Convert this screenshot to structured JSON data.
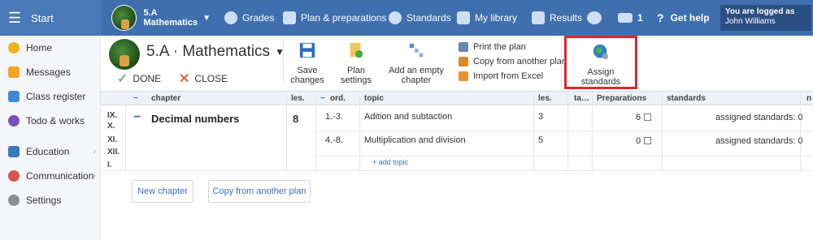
{
  "topbar": {
    "start_label": "Start",
    "class_name": "5.A",
    "class_subject": "Mathematics",
    "nav": [
      {
        "label": "Grades",
        "icon": "grades-icon"
      },
      {
        "label": "Plan & preparations",
        "icon": "plan-icon"
      },
      {
        "label": "Standards",
        "icon": "shield-icon"
      },
      {
        "label": "My library",
        "icon": "library-icon"
      },
      {
        "label": "Results",
        "icon": "results-icon"
      }
    ],
    "mail_count": "1",
    "help_label": "Get help",
    "logged_as_label": "You are logged as",
    "user_name": "John Williams"
  },
  "sidebar": {
    "items": [
      {
        "label": "Home",
        "icon": "star-icon",
        "color": "#f2b21c"
      },
      {
        "label": "Messages",
        "icon": "envelope-icon",
        "color": "#f5a623"
      },
      {
        "label": "Class register",
        "icon": "register-icon",
        "color": "#3a8bd6"
      },
      {
        "label": "Todo & works",
        "icon": "clock-icon",
        "color": "#7c4dbd"
      },
      {
        "label": "Education",
        "icon": "book-icon",
        "color": "#3a7ac0"
      },
      {
        "label": "Communication",
        "icon": "chat-icon",
        "color": "#d9534f"
      },
      {
        "label": "Settings",
        "icon": "gear-icon",
        "color": "#8a8f96"
      }
    ]
  },
  "toolbar": {
    "title": "5.A · Mathematics",
    "done_label": "DONE",
    "close_label": "CLOSE",
    "save_label_1": "Save",
    "save_label_2": "changes",
    "plan_settings_1": "Plan",
    "plan_settings_2": "settings",
    "add_chapter_1": "Add an empty",
    "add_chapter_2": "chapter",
    "print_label": "Print the plan",
    "copy_label": "Copy from another plan",
    "import_label": "Import from Excel",
    "assign_1": "Assign",
    "assign_2": "standards"
  },
  "table": {
    "headers": [
      "chapter",
      "les.",
      "ord.",
      "topic",
      "les.",
      "ta…",
      "Preparations",
      "standards",
      "n"
    ],
    "month_rows": [
      "IX.",
      "X.",
      "XI.",
      "XII.",
      "I."
    ],
    "chapter": {
      "name": "Decimal numbers",
      "lessons": "8"
    },
    "topics": [
      {
        "ord": "1.-3.",
        "topic": "Adition and subtaction",
        "lessons": "3",
        "preparations": "6",
        "standards": "assigned standards: 0"
      },
      {
        "ord": "4.-8.",
        "topic": "Multiplication and division",
        "lessons": "5",
        "preparations": "0",
        "standards": "assigned standards: 0"
      }
    ],
    "add_topic_label": "+ add topic"
  },
  "buttons": {
    "new_chapter": "New chapter",
    "copy_plan": "Copy from another plan"
  }
}
